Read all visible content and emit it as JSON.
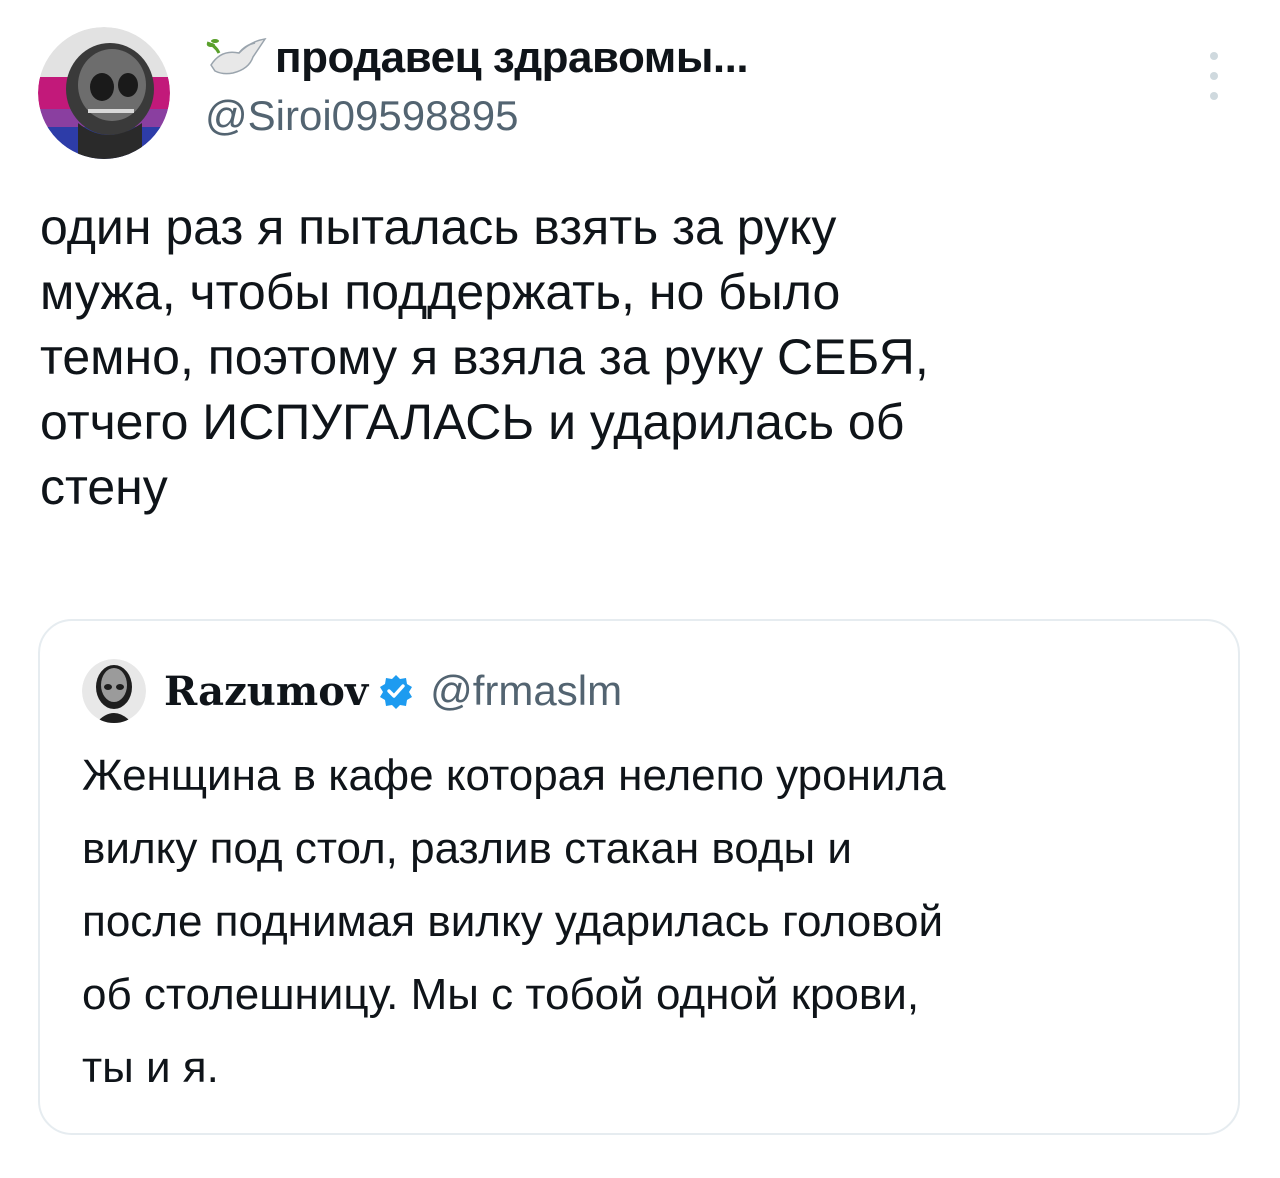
{
  "author": {
    "display_name": "продавец здравомы...",
    "handle": "@Siroi09598895",
    "avatar_icon": "skull-avatar-icon",
    "name_emoji": "dove-icon"
  },
  "tweet": {
    "text_lines": [
      "один раз я пыталась взять за руку",
      "мужа, чтобы поддержать, но было",
      "темно, поэтому я взяла за руку СЕБЯ,",
      "отчего ИСПУГАЛАСЬ и ударилась об",
      "стену"
    ]
  },
  "menu": {
    "icon": "more-vertical-icon"
  },
  "quoted_tweet": {
    "display_name": "Razumov",
    "handle": "@frmaslm",
    "verified": true,
    "avatar_icon": "alien-avatar-icon",
    "text_lines": [
      "Женщина в кафе которая нелепо уронила",
      "вилку под стол, разлив стакан  воды и",
      "после поднимая вилку ударилась головой",
      "об столешницу. Мы с тобой одной крови,",
      "ты и я."
    ]
  },
  "colors": {
    "text": "#0f1419",
    "secondary": "#536471",
    "border": "#e6ecf0",
    "verified": "#1d9bf0"
  }
}
